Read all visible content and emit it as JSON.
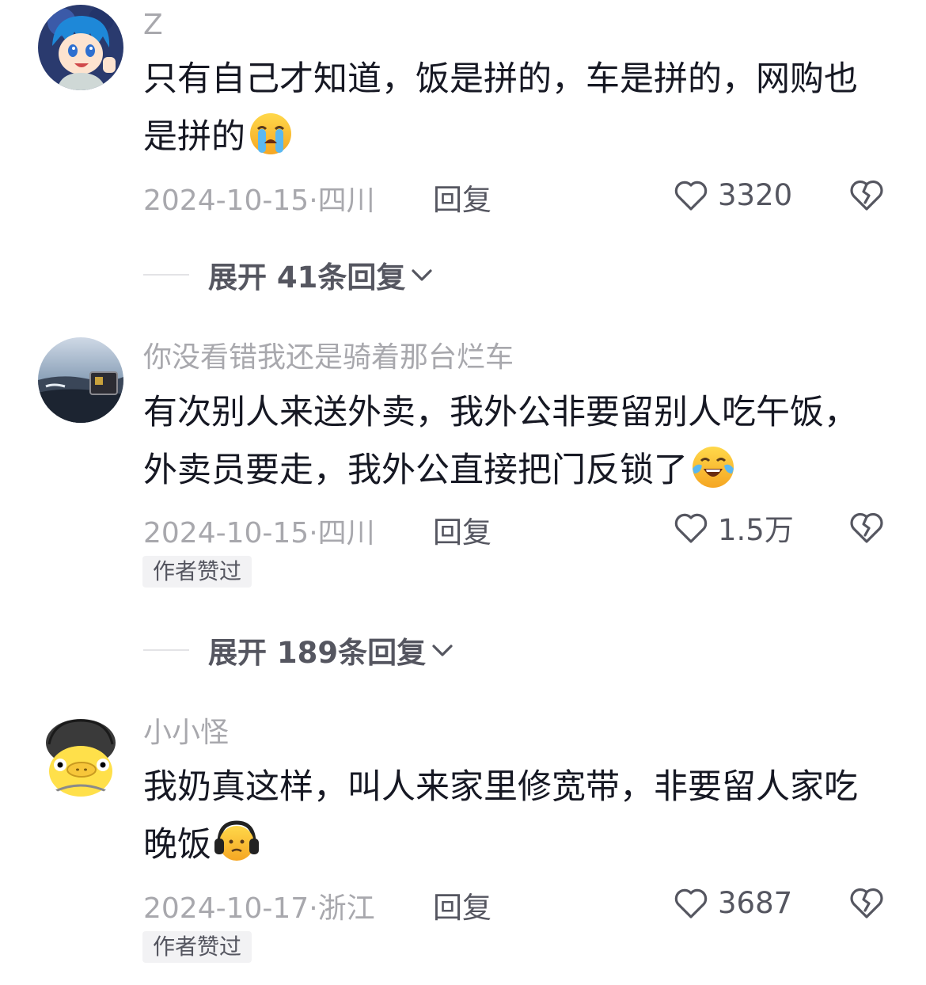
{
  "comments": [
    {
      "username": "Z",
      "text": "只有自己才知道，饭是拼的，车是拼的，网购也是拼的",
      "emoji": "crying-face",
      "date": "2024-10-15",
      "location": "四川",
      "reply_label": "回复",
      "likes": "3320",
      "author_liked": false,
      "expand_label": "展开 41条回复"
    },
    {
      "username": "你没看错我还是骑着那台烂车",
      "text": "有次别人来送外卖，我外公非要留别人吃午饭，外卖员要走，我外公直接把门反锁了",
      "emoji": "tears-of-joy-face",
      "date": "2024-10-15",
      "location": "四川",
      "reply_label": "回复",
      "likes": "1.5万",
      "author_liked": true,
      "badge": "作者赞过",
      "expand_label": "展开 189条回复"
    },
    {
      "username": "小小怪",
      "text": "我奶真这样，叫人来家里修宽带，非要留人家吃晚饭",
      "emoji": "headphones-face",
      "date": "2024-10-17",
      "location": "浙江",
      "reply_label": "回复",
      "likes": "3687",
      "author_liked": true,
      "badge": "作者赞过"
    }
  ],
  "meta_separator": "·",
  "colors": {
    "text": "#161823",
    "muted": "#a8a8ad",
    "secondary": "#555660",
    "badge_bg": "#f2f2f4"
  }
}
